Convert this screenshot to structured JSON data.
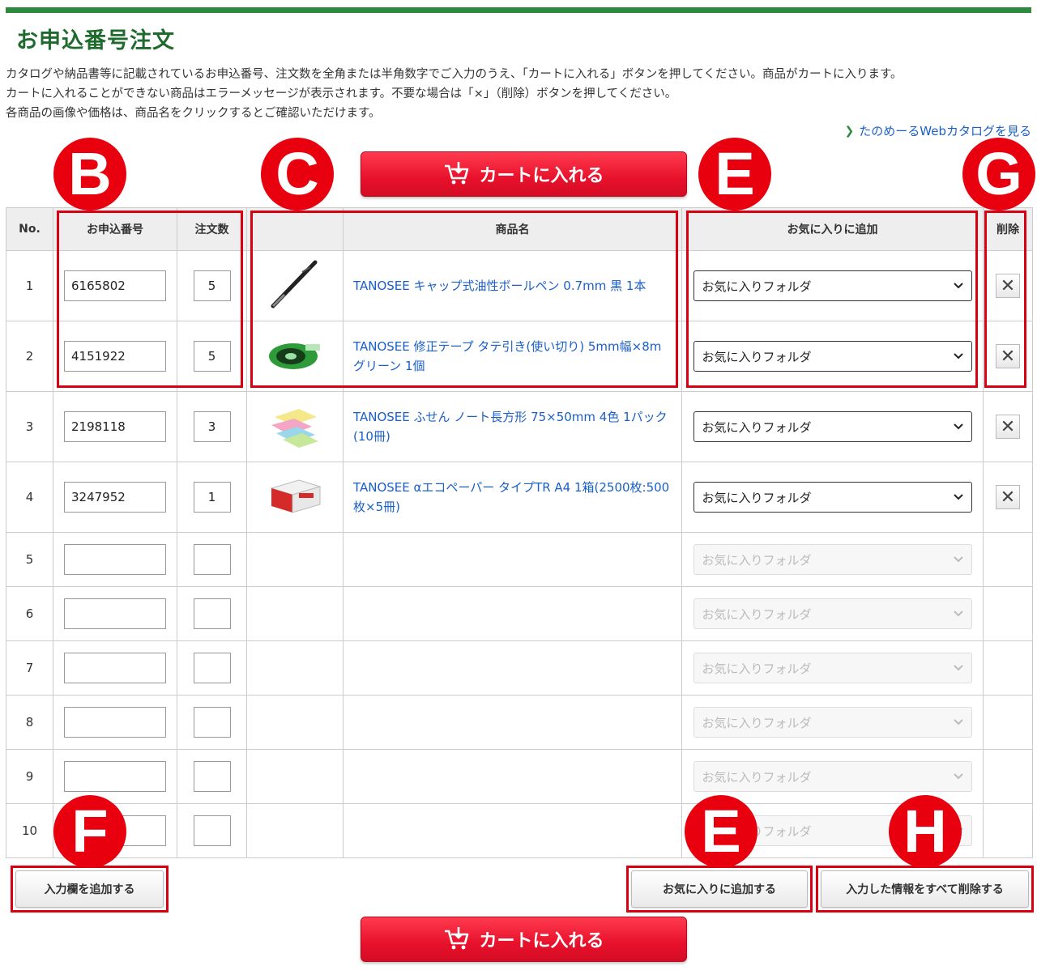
{
  "page_title": "お申込番号注文",
  "description": [
    "カタログや納品書等に記載されているお申込番号、注文数を全角または半角数字でご入力のうえ、「カートに入れる」ボタンを押してください。商品がカートに入ります。",
    "カートに入れることができない商品はエラーメッセージが表示されます。不要な場合は「×」（削除）ボタンを押してください。",
    "各商品の画像や価格は、商品名をクリックするとご確認いただけます。"
  ],
  "catalog_link": "たのめーるWebカタログを見る",
  "cart_button": "カートに入れる",
  "badges": {
    "b": "B",
    "c": "C",
    "e1": "E",
    "g": "G",
    "f": "F",
    "e2": "E",
    "h": "H"
  },
  "table": {
    "headers": {
      "no": "No.",
      "code": "お申込番号",
      "qty": "注文数",
      "image": "",
      "name": "商品名",
      "favorite": "お気に入りに追加",
      "delete": "削除"
    },
    "folder_placeholder": "お気に入りフォルダ",
    "rows": [
      {
        "no": "1",
        "code": "6165802",
        "qty": "5",
        "name": "TANOSEE キャップ式油性ボールペン 0.7mm 黒 1本",
        "image": "pen"
      },
      {
        "no": "2",
        "code": "4151922",
        "qty": "5",
        "name": "TANOSEE 修正テープ タテ引き(使い切り) 5mm幅×8m グリーン 1個",
        "image": "tape"
      },
      {
        "no": "3",
        "code": "2198118",
        "qty": "3",
        "name": "TANOSEE ふせん ノート長方形 75×50mm 4色 1パック(10冊)",
        "image": "sticky"
      },
      {
        "no": "4",
        "code": "3247952",
        "qty": "1",
        "name": "TANOSEE αエコペーパー タイプTR A4 1箱(2500枚:500枚×5冊)",
        "image": "paper"
      },
      {
        "no": "5",
        "code": "",
        "qty": "",
        "name": ""
      },
      {
        "no": "6",
        "code": "",
        "qty": "",
        "name": ""
      },
      {
        "no": "7",
        "code": "",
        "qty": "",
        "name": ""
      },
      {
        "no": "8",
        "code": "",
        "qty": "",
        "name": ""
      },
      {
        "no": "9",
        "code": "",
        "qty": "",
        "name": ""
      },
      {
        "no": "10",
        "code": "",
        "qty": "",
        "name": ""
      }
    ]
  },
  "buttons": {
    "add_rows": "入力欄を追加する",
    "add_favorite": "お気に入りに追加する",
    "clear_all": "入力した情報をすべて削除する"
  },
  "colors": {
    "accent_green": "#2e8b3e",
    "cart_red": "#e8112c",
    "link_blue": "#1a5fc8",
    "badge_red": "#e8000f"
  }
}
